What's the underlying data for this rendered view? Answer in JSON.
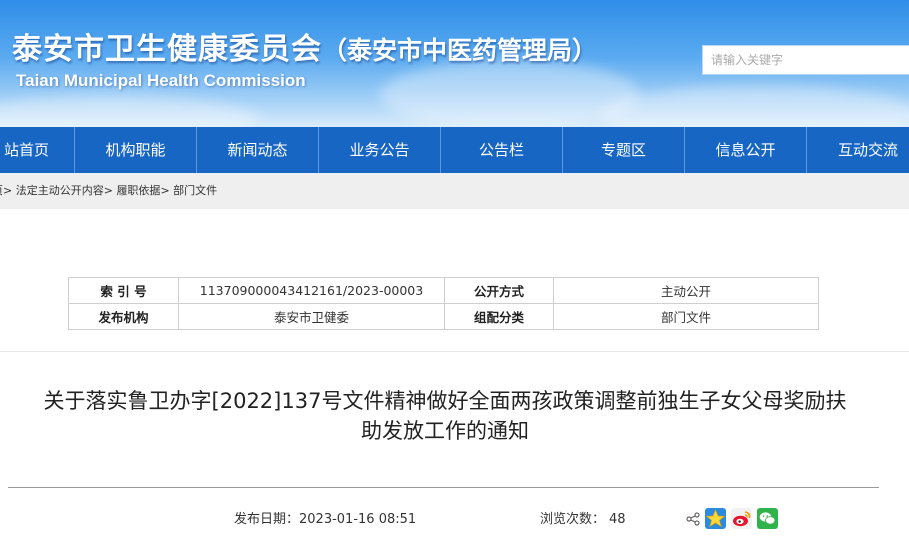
{
  "header": {
    "title": "泰安市卫生健康委员会",
    "subtitle": "（泰安市中医药管理局）",
    "title_en": "Taian Municipal Health Commission",
    "search_placeholder": "请输入关键字"
  },
  "nav": {
    "items": [
      {
        "label": "站首页"
      },
      {
        "label": "机构职能"
      },
      {
        "label": "新闻动态"
      },
      {
        "label": "业务公告"
      },
      {
        "label": "公告栏"
      },
      {
        "label": "专题区"
      },
      {
        "label": "信息公开"
      },
      {
        "label": "互动交流"
      }
    ]
  },
  "breadcrumb": {
    "items": [
      "页",
      "法定主动公开内容",
      "履职依据",
      "部门文件"
    ],
    "separator": ">"
  },
  "meta": {
    "index_no_label": "索 引 号",
    "index_no": "113709000043412161/2023-00003",
    "open_mode_label": "公开方式",
    "open_mode": "主动公开",
    "publisher_label": "发布机构",
    "publisher": "泰安市卫健委",
    "category_label": "组配分类",
    "category": "部门文件"
  },
  "article": {
    "title_line1": "关于落实鲁卫办字[2022]137号文件精神做好全面两孩政策调整前独生子女父母奖励扶",
    "title_line2": "助发放工作的通知",
    "publish_date_label": "发布日期：",
    "publish_date": "2023-01-16 08:51",
    "views_label": "浏览次数：",
    "views": "48"
  },
  "share": {
    "icons": [
      "share-icon",
      "qzone-icon",
      "weibo-icon",
      "wechat-icon"
    ]
  },
  "colors": {
    "nav_bg": "#1766c4",
    "header_top": "#2f8ee8",
    "crumb_bg": "#efefef"
  }
}
